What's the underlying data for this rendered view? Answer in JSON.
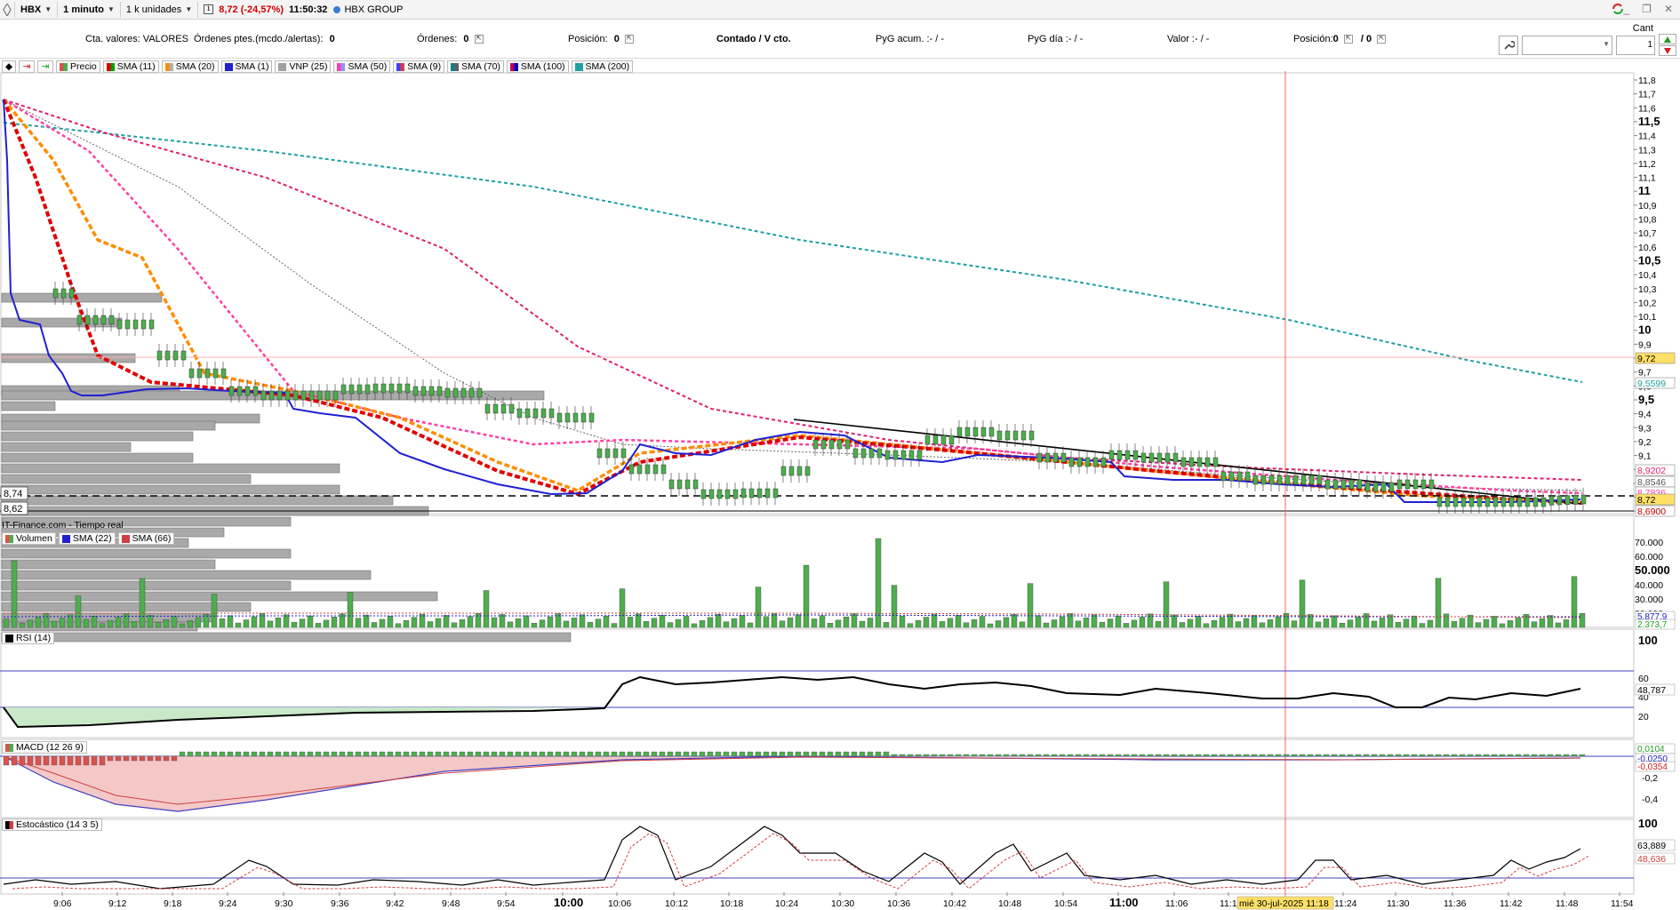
{
  "topbar": {
    "symbol": "HBX",
    "interval": "1 minuto",
    "units": "1 k unidades",
    "info_icon": "i",
    "price": "8,72 (-24,57%)",
    "time": "11:50:32",
    "company": "HBX GROUP"
  },
  "infobar": {
    "account": "Cta. valores: VALORES",
    "pending_orders": "Órdenes ptes.(mcdo./alertas):",
    "pending_orders_value": "0",
    "orders": "Órdenes:",
    "orders_value": "0",
    "position": "Posición:",
    "position_value": "0",
    "mode": "Contado / V cto.",
    "pyg_acum": "PyG acum. :- / -",
    "pyg_dia": "PyG día :- / -",
    "valor": "Valor :- / -",
    "position2": "Posición:",
    "position2_value": "0",
    "position2_sep": "/ 0",
    "cant_label": "Cant",
    "cant_value": "1"
  },
  "legend": [
    {
      "label": "Precio",
      "colors": [
        "#d9534f",
        "#4cae4c"
      ]
    },
    {
      "label": "SMA (11)",
      "colors": [
        "#e00000",
        "#00a000"
      ]
    },
    {
      "label": "SMA (20)",
      "colors": [
        "#ff8c00",
        "#b0b0b0"
      ]
    },
    {
      "label": "SMA (1)",
      "colors": [
        "#2020d0"
      ]
    },
    {
      "label": "VNP (25)",
      "colors": [
        "#a0a0a0"
      ]
    },
    {
      "label": "SMA (50)",
      "colors": [
        "#ff40a0",
        "#9090ff"
      ]
    },
    {
      "label": "SMA (9)",
      "colors": [
        "#4040ff",
        "#d04040"
      ]
    },
    {
      "label": "SMA (70)",
      "colors": [
        "#108080",
        "#606060"
      ]
    },
    {
      "label": "SMA (100)",
      "colors": [
        "#c00060",
        "#0000c0"
      ]
    },
    {
      "label": "SMA (200)",
      "colors": [
        "#20a0a0"
      ]
    }
  ],
  "price_axis": {
    "ticks": [
      "11,8",
      "11,7",
      "11,6",
      "11,5",
      "11,4",
      "11,3",
      "11,2",
      "11,1",
      "11",
      "10,9",
      "10,8",
      "10,7",
      "10,6",
      "10,5",
      "10,4",
      "10,3",
      "10,2",
      "10,1",
      "10",
      "9,9",
      "9,8",
      "9,7",
      "9,6",
      "9,5",
      "9,4",
      "9,3",
      "9,2",
      "9,1",
      "9",
      "8,9",
      "8,8",
      "8,7"
    ],
    "bold_ticks": [
      "11,5",
      "11",
      "10,5",
      "10",
      "9,5",
      "9"
    ],
    "tags": [
      {
        "text": "9,72",
        "bg": "#ffe066",
        "fg": "#000"
      },
      {
        "text": "9,5599",
        "bg": "#ffffff",
        "fg": "#20a0a0"
      },
      {
        "text": "8,9202",
        "bg": "#ffffff",
        "fg": "#e0206e"
      },
      {
        "text": "8,8546",
        "bg": "#ffffff",
        "fg": "#555555"
      },
      {
        "text": "8,7836",
        "bg": "#ffffff",
        "fg": "#ff40a0"
      },
      {
        "text": "8,72",
        "bg": "#ffe066",
        "fg": "#000"
      },
      {
        "text": "8,6900",
        "bg": "#ffffff",
        "fg": "#c00000"
      }
    ],
    "left_tags": [
      "8,74",
      "8,62"
    ]
  },
  "volume_panel": {
    "source": "IT-Finance.com - Tiempo real",
    "legend": [
      {
        "label": "Volumen",
        "colors": [
          "#d9534f",
          "#4cae4c"
        ]
      },
      {
        "label": "SMA (22)",
        "colors": [
          "#2020d0"
        ]
      },
      {
        "label": "SMA (66)",
        "colors": [
          "#d04040"
        ]
      }
    ],
    "ticks": [
      "70.000",
      "60.000",
      "50.000",
      "40.000",
      "30.000",
      "20.000"
    ],
    "bold_tick": "50.000",
    "tags": [
      "5.877,9",
      "2.373,7"
    ]
  },
  "rsi_panel": {
    "label": "RSI (14)",
    "ticks": [
      "100",
      "60",
      "40",
      "20"
    ],
    "value": "48,787"
  },
  "macd_panel": {
    "label": "MACD (12 26 9)",
    "ticks": [
      "-0,2",
      "-0,4"
    ],
    "tags": [
      "0,0104",
      "-0,0250",
      "-0,0354"
    ]
  },
  "stoch_panel": {
    "label": "Estocástico (14 3 5)",
    "ticks": [
      "100"
    ],
    "tags": [
      "63,889",
      "48,636"
    ]
  },
  "time_axis": {
    "labels": [
      "9:06",
      "9:12",
      "9:18",
      "9:24",
      "9:30",
      "9:36",
      "9:42",
      "9:48",
      "9:54",
      "10:00",
      "10:06",
      "10:12",
      "10:18",
      "10:24",
      "10:30",
      "10:36",
      "10:42",
      "10:48",
      "10:54",
      "11:00",
      "11:06",
      "11:1",
      "11:24",
      "11:30",
      "11:36",
      "11:42",
      "11:48",
      "11:54"
    ],
    "bold_labels": [
      "10:00",
      "11:00"
    ],
    "cursor_label": "mié 30-jul-2025 11:18"
  },
  "colors": {
    "up": "#4cae4c",
    "down": "#d9534f",
    "price_line": "#2020d0",
    "sma200": "#20a0a0",
    "sma100": "#e0206e",
    "sma50": "#ff40a0",
    "sma20": "#ff8c00",
    "sma11": "#e00000",
    "cursor": "#ff6060"
  }
}
